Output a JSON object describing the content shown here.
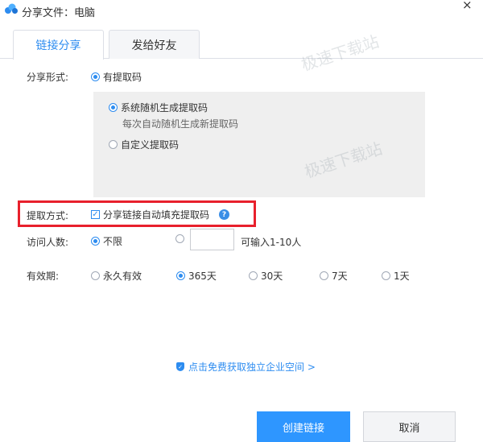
{
  "window": {
    "title": "分享文件：电脑"
  },
  "tabs": [
    {
      "label": "链接分享",
      "active": true
    },
    {
      "label": "发给好友",
      "active": false
    }
  ],
  "share_form": {
    "label": "分享形式:",
    "option": "有提取码",
    "sub_options": [
      {
        "label": "系统随机生成提取码",
        "hint": "每次自动随机生成新提取码",
        "selected": true
      },
      {
        "label": "自定义提取码",
        "selected": false
      }
    ]
  },
  "extract_method": {
    "label": "提取方式:",
    "checkbox_label": "分享链接自动填充提取码",
    "checked": true
  },
  "visitors": {
    "label": "访问人数:",
    "unlimited": "不限",
    "input_value": "",
    "hint": "可输入1-10人"
  },
  "validity": {
    "label": "有效期:",
    "options": [
      "永久有效",
      "365天",
      "30天",
      "7天",
      "1天"
    ],
    "selected": "365天"
  },
  "promo_link": "点击免费获取独立企业空间 >",
  "buttons": {
    "create": "创建链接",
    "cancel": "取消"
  },
  "watermark": "极速下载站",
  "colors": {
    "accent": "#2d8cf0",
    "highlight": "#e8202c",
    "primary_button": "#2e96ff"
  }
}
